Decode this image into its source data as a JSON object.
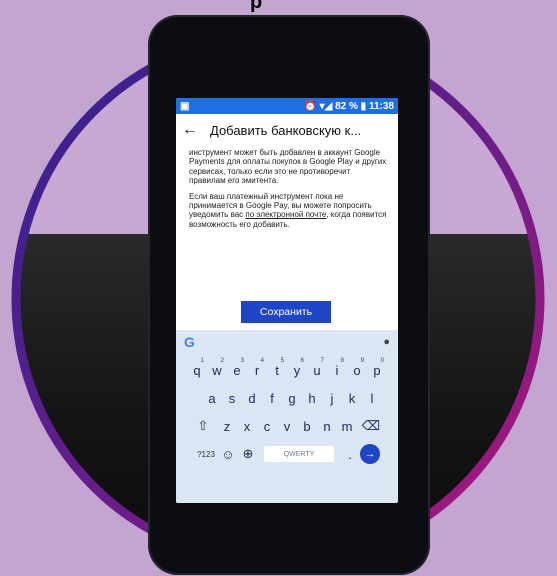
{
  "header_text": "р",
  "status_bar": {
    "left_icon": "notification-icon",
    "right": "⏰ ▾◢ 82 % ▮ 11:38"
  },
  "app_bar": {
    "back": "←",
    "title": "Добавить банковскую к..."
  },
  "content": {
    "paragraph1": "инструмент может быть добавлен в аккаунт Google Payments для оплаты покупок в Google Play и других сервисах, только если это не противоречит правилам его эмитента.",
    "paragraph2_part1": "Если ваш платежный инструмент пока не принимается в Google Pay, вы можете попросить уведомить вас ",
    "paragraph2_link": "по электронной почте",
    "paragraph2_part2": ", когда появится возможность его добавить."
  },
  "save_button": "Сохранить",
  "keyboard": {
    "row1": [
      {
        "k": "q",
        "n": "1"
      },
      {
        "k": "w",
        "n": "2"
      },
      {
        "k": "e",
        "n": "3"
      },
      {
        "k": "r",
        "n": "4"
      },
      {
        "k": "t",
        "n": "5"
      },
      {
        "k": "y",
        "n": "6"
      },
      {
        "k": "u",
        "n": "7"
      },
      {
        "k": "i",
        "n": "8"
      },
      {
        "k": "o",
        "n": "9"
      },
      {
        "k": "p",
        "n": "0"
      }
    ],
    "row2": [
      "a",
      "s",
      "d",
      "f",
      "g",
      "h",
      "j",
      "k",
      "l"
    ],
    "row3": [
      "⇧",
      "z",
      "x",
      "c",
      "v",
      "b",
      "n",
      "m",
      "⌫"
    ],
    "row4": {
      "sym": "?123",
      "emoji": "☺",
      "globe": "⊕",
      "space": "QWERTY",
      "period": ".",
      "enter": "→"
    }
  },
  "colors": {
    "status_blue": "#1f6fe0",
    "button_blue": "#1d45c6",
    "keyboard_bg": "#dbe6f5",
    "ring_start": "#3b1f8c",
    "ring_end": "#a1127a"
  }
}
